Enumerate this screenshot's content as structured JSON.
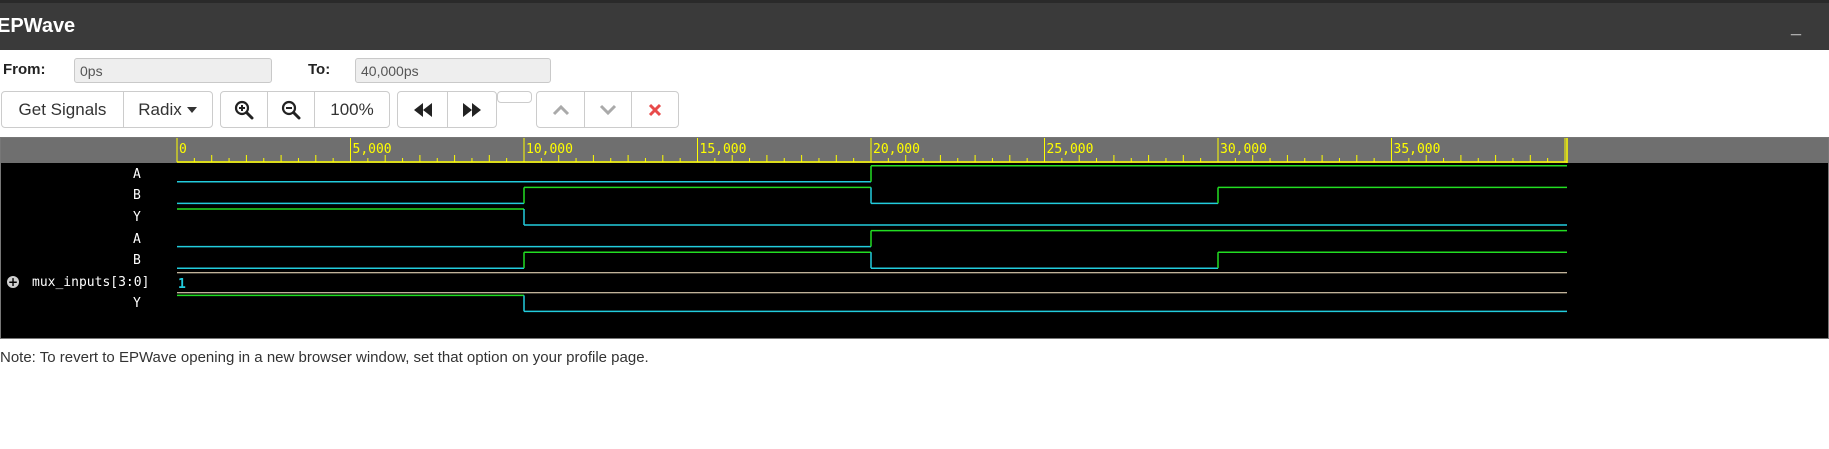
{
  "window": {
    "title": "EPWave",
    "minimize_glyph": "_"
  },
  "range": {
    "from_label": "From:",
    "from_value": "0ps",
    "to_label": "To:",
    "to_value": "40,000ps"
  },
  "toolbar": {
    "get_signals_label": "Get Signals",
    "radix_label": "Radix",
    "zoom_in_icon": "magnifier-plus",
    "zoom_out_icon": "magnifier-minus",
    "zoom_level": "100%",
    "prev_transition_icon": "double-left-arrow",
    "next_transition_icon": "double-right-arrow",
    "move_up_icon": "chevron-up",
    "move_down_icon": "chevron-down",
    "remove_icon": "x-mark",
    "remove_color": "#e84a4a"
  },
  "ruler": {
    "tick_labels": [
      "0",
      "5,000",
      "10,000",
      "15,000",
      "20,000",
      "25,000",
      "30,000",
      "35,000"
    ],
    "max": 40000,
    "color": "#ffff00"
  },
  "signals": [
    {
      "name": "A",
      "kind": "bit",
      "transitions": [
        [
          0,
          0
        ],
        [
          20000,
          1
        ]
      ]
    },
    {
      "name": "B",
      "kind": "bit",
      "transitions": [
        [
          0,
          0
        ],
        [
          10000,
          1
        ],
        [
          20000,
          0
        ],
        [
          30000,
          1
        ]
      ]
    },
    {
      "name": "Y",
      "kind": "bit",
      "transitions": [
        [
          0,
          1
        ],
        [
          10000,
          0
        ]
      ]
    },
    {
      "name": "A",
      "kind": "bit",
      "transitions": [
        [
          0,
          0
        ],
        [
          20000,
          1
        ]
      ]
    },
    {
      "name": "B",
      "kind": "bit",
      "transitions": [
        [
          0,
          0
        ],
        [
          10000,
          1
        ],
        [
          20000,
          0
        ],
        [
          30000,
          1
        ]
      ]
    },
    {
      "name": "mux_inputs[3:0]",
      "kind": "bus",
      "value": "1",
      "expand_icon": "plus-circle"
    },
    {
      "name": "Y",
      "kind": "bit",
      "transitions": [
        [
          0,
          1
        ],
        [
          10000,
          0
        ]
      ]
    }
  ],
  "colors": {
    "high": "#22dd22",
    "low": "#22ccdd",
    "bus_line": "#ffeecc",
    "bus_text": "#22ccdd"
  },
  "note": "Note: To revert to EPWave opening in a new browser window, set that option on your profile page."
}
